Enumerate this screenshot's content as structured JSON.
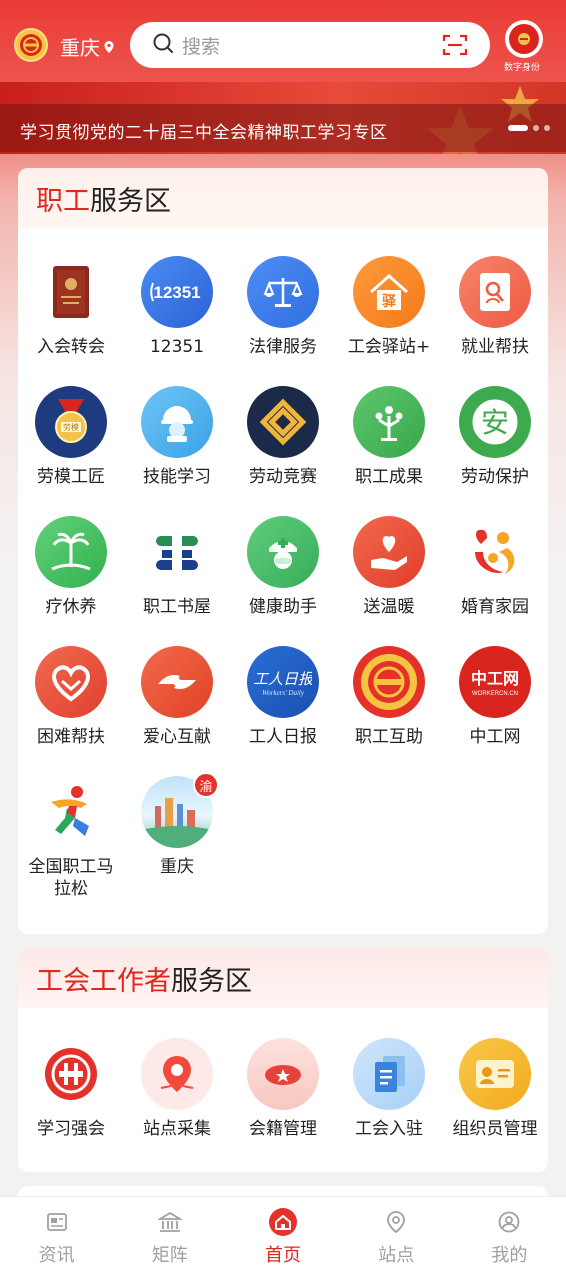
{
  "header": {
    "city": "重庆",
    "search_placeholder": "搜索",
    "digital_id_label": "数字身份"
  },
  "banner": {
    "text": "学习贯彻党的二十届三中全会精神职工学习专区"
  },
  "worker_section": {
    "title_highlight": "职工",
    "title_rest": "服务区",
    "items": [
      {
        "label": "入会转会",
        "icon": "membership-book-icon"
      },
      {
        "label": "12351",
        "icon": "hotline-12351-icon"
      },
      {
        "label": "法律服务",
        "icon": "scales-icon"
      },
      {
        "label": "工会驿站+",
        "icon": "station-house-icon"
      },
      {
        "label": "就业帮扶",
        "icon": "job-search-icon"
      },
      {
        "label": "劳模工匠",
        "icon": "medal-icon"
      },
      {
        "label": "技能学习",
        "icon": "worker-helmet-icon"
      },
      {
        "label": "劳动竞赛",
        "icon": "competition-knot-icon"
      },
      {
        "label": "职工成果",
        "icon": "tree-people-icon"
      },
      {
        "label": "劳动保护",
        "icon": "safety-seal-icon"
      },
      {
        "label": "疗休养",
        "icon": "palm-beach-icon"
      },
      {
        "label": "职工书屋",
        "icon": "book-house-icon"
      },
      {
        "label": "健康助手",
        "icon": "medical-cap-icon"
      },
      {
        "label": "送温暖",
        "icon": "heart-hand-icon"
      },
      {
        "label": "婚育家园",
        "icon": "family-heart-icon"
      },
      {
        "label": "困难帮扶",
        "icon": "support-heart-icon"
      },
      {
        "label": "爱心互献",
        "icon": "giving-hands-icon"
      },
      {
        "label": "工人日报",
        "icon": "workers-daily-icon"
      },
      {
        "label": "职工互助",
        "icon": "union-emblem-icon"
      },
      {
        "label": "中工网",
        "icon": "workercn-icon"
      },
      {
        "label": "全国职工马拉松",
        "icon": "runner-icon"
      },
      {
        "label": "重庆",
        "icon": "chongqing-city-icon",
        "badge": "渝"
      }
    ]
  },
  "union_section": {
    "title_highlight": "工会工作者",
    "title_rest": "服务区",
    "items": [
      {
        "label": "学习强会",
        "icon": "union-study-icon"
      },
      {
        "label": "站点采集",
        "icon": "map-pin-icon"
      },
      {
        "label": "会籍管理",
        "icon": "membership-manage-icon"
      },
      {
        "label": "工会入驻",
        "icon": "document-stack-icon"
      },
      {
        "label": "组织员管理",
        "icon": "id-card-icon"
      }
    ]
  },
  "tabbar": {
    "tabs": [
      {
        "label": "资讯",
        "icon": "news-icon"
      },
      {
        "label": "矩阵",
        "icon": "building-icon"
      },
      {
        "label": "首页",
        "icon": "home-icon",
        "active": true
      },
      {
        "label": "站点",
        "icon": "location-icon"
      },
      {
        "label": "我的",
        "icon": "user-icon"
      }
    ]
  }
}
